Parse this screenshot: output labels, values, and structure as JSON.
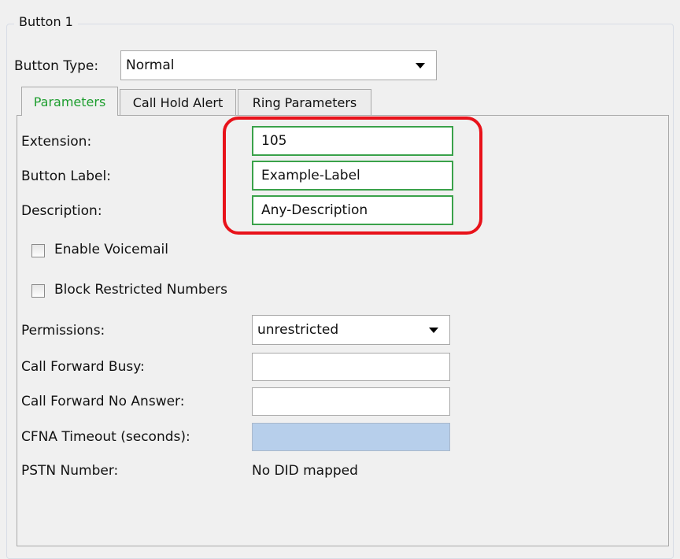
{
  "group": {
    "title": "Button 1"
  },
  "button_type": {
    "label": "Button Type:",
    "value": "Normal"
  },
  "tabs": [
    {
      "label": "Parameters",
      "active": true
    },
    {
      "label": "Call Hold Alert",
      "active": false
    },
    {
      "label": "Ring Parameters",
      "active": false
    }
  ],
  "parameters": {
    "extension": {
      "label": "Extension:",
      "value": "105"
    },
    "button_label": {
      "label": "Button Label:",
      "value": "Example-Label"
    },
    "description": {
      "label": "Description:",
      "value": "Any-Description"
    },
    "enable_voicemail": {
      "label": "Enable Voicemail",
      "checked": false
    },
    "block_restricted": {
      "label": "Block Restricted Numbers",
      "checked": false
    },
    "permissions": {
      "label": "Permissions:",
      "value": "unrestricted"
    },
    "call_forward_busy": {
      "label": "Call Forward Busy:",
      "value": ""
    },
    "call_forward_no_answer": {
      "label": "Call Forward No Answer:",
      "value": ""
    },
    "cfna_timeout": {
      "label": "CFNA Timeout (seconds):",
      "value": ""
    },
    "pstn_number": {
      "label": "PSTN Number:",
      "value": "No DID mapped"
    }
  },
  "colors": {
    "active_tab_text": "#1e9e2f",
    "highlight_border": "#e8121a",
    "green_field_border": "#3aa24a",
    "disabled_field_bg": "#b7cfeb"
  }
}
